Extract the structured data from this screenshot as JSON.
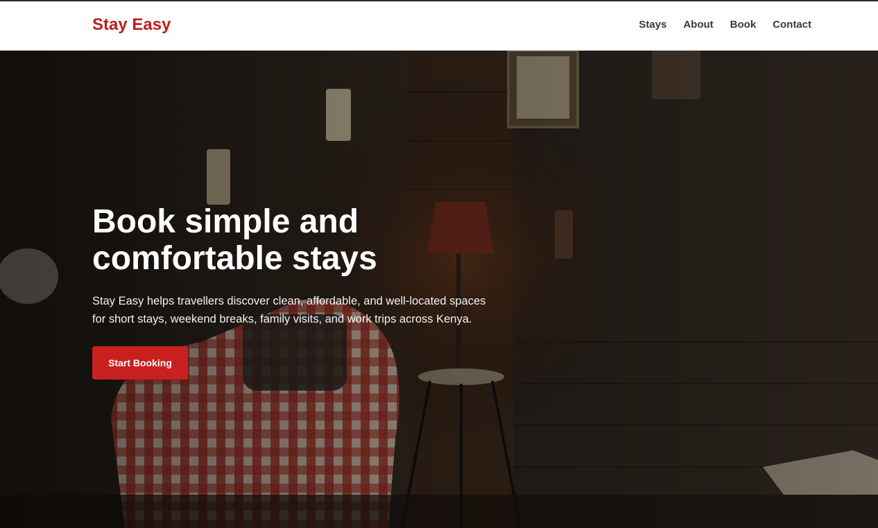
{
  "header": {
    "brand": "Stay Easy",
    "nav": [
      {
        "label": "Stays"
      },
      {
        "label": "About"
      },
      {
        "label": "Book"
      },
      {
        "label": "Contact"
      }
    ]
  },
  "hero": {
    "title": "Book simple and comfortable stays",
    "description": "Stay Easy helps travellers discover clean, affordable, and well-located spaces for short stays, weekend breaks, family visits, and work trips across Kenya.",
    "cta_label": "Start Booking",
    "background_image": "dark cozy living room with red plaid armchair, table lamp and side stool"
  },
  "colors": {
    "brand": "#b91f1f",
    "cta": "#c8201f",
    "nav_text": "#3a3a3a"
  }
}
